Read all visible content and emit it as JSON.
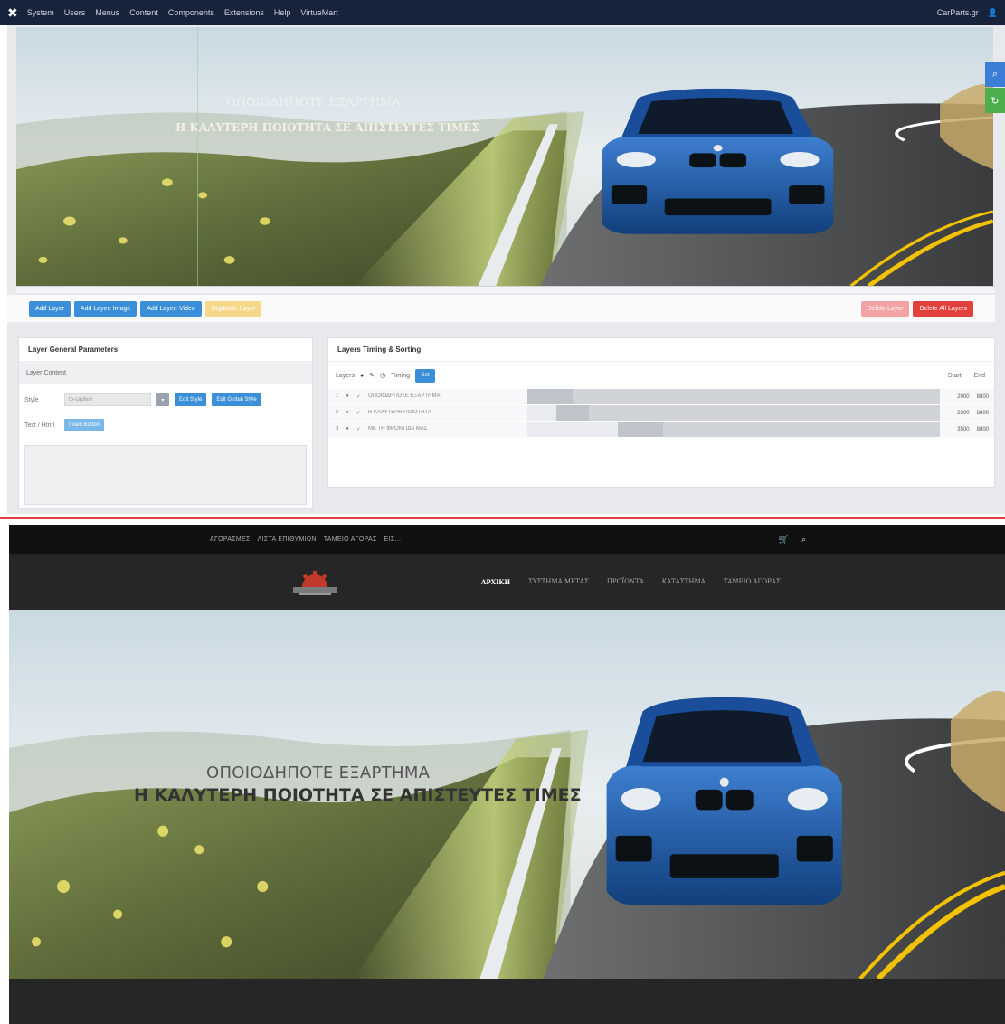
{
  "admin_bar": {
    "logo": "✖",
    "menu": [
      "System",
      "Users",
      "Menus",
      "Content",
      "Components",
      "Extensions",
      "Help",
      "VirtueMart"
    ],
    "site_label": "CarParts.gr",
    "user_label": "👤"
  },
  "editor": {
    "slide": {
      "line1": "ΟΠΟΙΟΔΗΠΟΤΕ ΕΞΑΡΤΗΜΑ",
      "line2": "Η ΚΑΛΥΤΕΡΗ ΠΟΙΟΤΗΤΑ ΣΕ ΑΠΙΣΤΕΥΤΕΣ ΤΙΜΕΣ"
    },
    "toolbar": {
      "add_layer": "Add Layer",
      "add_layer_image": "Add Layer: Image",
      "add_layer_video": "Add Layer: Video",
      "duplicate_layer": "Duplicate Layer",
      "delete_layer": "Delete Layer",
      "delete_all_layers": "Delete All Layers"
    },
    "params": {
      "title": "Layer General Parameters",
      "tab": "Layer Content",
      "style_label": "Style",
      "style_value": "tp-caption",
      "edit_style": "Edit Style",
      "edit_global_style": "Edit Global Style",
      "text_label": "Text / Html",
      "insert_button": "Insert Button"
    },
    "timing": {
      "title": "Layers Timing & Sorting",
      "sort_label": "Layers",
      "timing_label": "Timing",
      "time_button": "Set",
      "start_label": "Start",
      "end_label": "End",
      "rows": [
        {
          "num": "1",
          "name": "ΟΠΟΙΟΔΗΠΟΤΕ ΕΞΑΡΤΗΜΑ",
          "start": "2000",
          "end": "8800",
          "bar_start": 0.0,
          "bar_dark_end": 0.11
        },
        {
          "num": "2",
          "name": "Η ΚΑΛΥΤΕΡΗ ΠΟΙΟΤΗΤΑ",
          "start": "2300",
          "end": "8800",
          "bar_start": 0.07,
          "bar_dark_end": 0.15
        },
        {
          "num": "3",
          "name": "ΜΕ ΤΗ ΦΡΟΝΤΙΔΑ ΜΑΣ",
          "start": "3500",
          "end": "8800",
          "bar_start": 0.22,
          "bar_dark_end": 0.33
        }
      ]
    }
  },
  "front": {
    "top_links": [
      "ΑΓΟΡΑΣΜΕΣ",
      "ΛΙΣΤΑ ΕΠΙΘΥΜΙΩΝ",
      "ΤΑΜΕΙΟ ΑΓΟΡΑΣ",
      "ΕΙΣ..."
    ],
    "top_icons": [
      "cart",
      "search"
    ],
    "menu": [
      "ΑΡΧΙΚΗ",
      "ΣΥΣΤΗΜΑ ΜΕΤΑΣ",
      "ΠΡΟΪΟΝΤΑ",
      "ΚΑΤΑΣΤΗΜΑ",
      "ΤΑΜΕΙΟ ΑΓΟΡΑΣ"
    ],
    "hero": {
      "line1": "ΟΠΟΙΟΔΗΠΟΤΕ ΕΞΑΡΤΗΜΑ",
      "line2": "Η ΚΑΛΥΤΕΡΗ ΠΟΙΟΤΗΤΑ ΣΕ ΑΠΙΣΤΕΥΤΕΣ ΤΙΜΕΣ"
    }
  }
}
